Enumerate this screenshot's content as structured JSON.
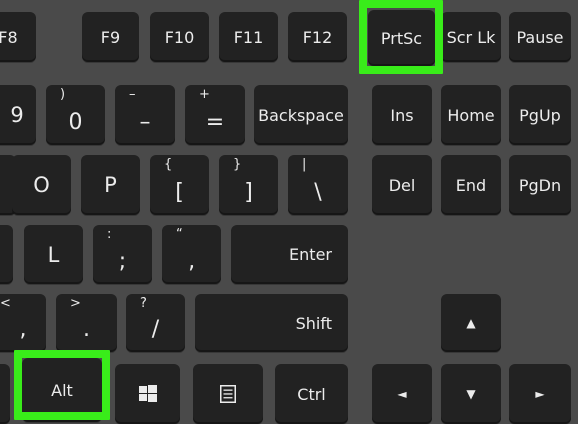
{
  "keys": {
    "f8": "F8",
    "f9": "F9",
    "f10": "F10",
    "f11": "F11",
    "f12": "F12",
    "prtsc": "PrtSc",
    "scrlk": "Scr Lk",
    "pause": "Pause",
    "nine": "9",
    "zero_shift": ")",
    "zero": "0",
    "minus_shift": "–",
    "minus": "–",
    "equals_shift": "+",
    "equals": "=",
    "backspace": "Backspace",
    "ins": "Ins",
    "home": "Home",
    "pgup": "PgUp",
    "o": "O",
    "p": "P",
    "lbracket_shift": "{",
    "lbracket": "[",
    "rbracket_shift": "}",
    "rbracket": "]",
    "backslash_shift": "|",
    "backslash": "\\",
    "del": "Del",
    "end": "End",
    "pgdn": "PgDn",
    "l": "L",
    "semicolon_shift": ":",
    "semicolon": ";",
    "quote_shift": "“",
    "quote": "‚",
    "enter": "Enter",
    "comma_shift": "<",
    "comma": ",",
    "period_shift": ">",
    "period": ".",
    "slash_shift": "?",
    "slash": "/",
    "shift": "Shift",
    "alt": "Alt",
    "ctrl": "Ctrl",
    "up_arrow": "▲",
    "left_arrow": "◄",
    "down_arrow": "▼",
    "right_arrow": "►"
  },
  "colors": {
    "background": "#4a4a4a",
    "key": "#222222",
    "key_text": "#ececec",
    "highlight": "#39ec1a"
  },
  "icons": {
    "windows_key": "windows-logo-icon",
    "menu_key": "context-menu-icon"
  },
  "highlighted_keys": [
    "PrtSc",
    "Alt"
  ]
}
